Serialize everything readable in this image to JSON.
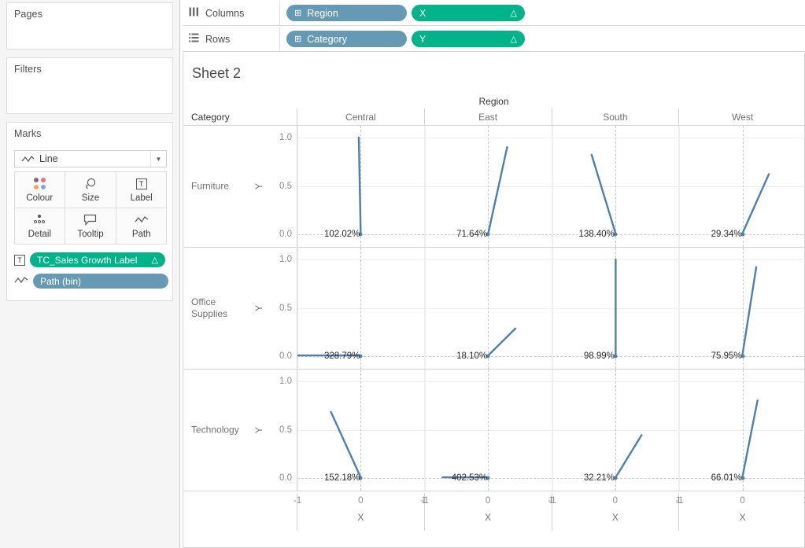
{
  "left_pane": {
    "pages": {
      "title": "Pages"
    },
    "filters": {
      "title": "Filters"
    },
    "marks": {
      "title": "Marks",
      "mark_type": "Line",
      "mark_type_icon": "line-chart-icon",
      "dropdown_arrow": "▼",
      "buttons": [
        {
          "label": "Colour",
          "icon": "colour-dots-icon"
        },
        {
          "label": "Size",
          "icon": "size-circle-icon"
        },
        {
          "label": "Label",
          "icon": "label-t-icon"
        },
        {
          "label": "Detail",
          "icon": "detail-dots-icon"
        },
        {
          "label": "Tooltip",
          "icon": "tooltip-bubble-icon"
        },
        {
          "label": "Path",
          "icon": "path-line-icon"
        }
      ],
      "pills": [
        {
          "icon": "label-t-icon",
          "text": "TC_Sales Growth Label",
          "agg": "△",
          "colour": "green"
        },
        {
          "icon": "path-line-icon",
          "text": "Path (bin)",
          "agg": "",
          "colour": "blue"
        }
      ]
    }
  },
  "shelves": {
    "columns": {
      "label": "Columns",
      "icon": "columns-shelf-icon",
      "pills": [
        {
          "icon": "⊞",
          "text": "Region",
          "agg": "",
          "colour": "blue"
        },
        {
          "icon": "",
          "text": "X",
          "agg": "△",
          "colour": "green"
        }
      ]
    },
    "rows": {
      "label": "Rows",
      "icon": "rows-shelf-icon",
      "pills": [
        {
          "icon": "⊞",
          "text": "Category",
          "agg": "",
          "colour": "blue"
        },
        {
          "icon": "",
          "text": "Y",
          "agg": "△",
          "colour": "green"
        }
      ]
    }
  },
  "view": {
    "sheet_title": "Sheet 2",
    "column_field_caption": "Region",
    "row_field_caption": "Category"
  },
  "chart_data": {
    "type": "line",
    "title": "Sheet 2",
    "xlabel": "X",
    "ylabel": "Y",
    "xlim": [
      -1,
      1
    ],
    "ylim": [
      0,
      1
    ],
    "x_ticks": [
      "-1",
      "0",
      "1"
    ],
    "x_tick_values": [
      -1,
      0,
      1
    ],
    "y_ticks": [
      "0.0",
      "0.5",
      "1.0"
    ],
    "y_tick_values": [
      0.0,
      0.5,
      1.0
    ],
    "grid": true,
    "legend": "none",
    "line_colour": "#4f7faf",
    "columns": [
      "Central",
      "East",
      "South",
      "West"
    ],
    "rows": [
      "Furniture",
      "Office Supplies",
      "Technology"
    ],
    "panels": [
      {
        "row": "Furniture",
        "col": "Central",
        "label": "102.02%",
        "points": [
          [
            0,
            0
          ],
          [
            -0.03,
            1.0
          ]
        ]
      },
      {
        "row": "Furniture",
        "col": "East",
        "label": "71.64%",
        "points": [
          [
            0,
            0
          ],
          [
            0.3,
            0.9
          ]
        ]
      },
      {
        "row": "Furniture",
        "col": "South",
        "label": "138.40%",
        "points": [
          [
            0,
            0
          ],
          [
            -0.38,
            0.82
          ]
        ]
      },
      {
        "row": "Furniture",
        "col": "West",
        "label": "29.34%",
        "points": [
          [
            0,
            0
          ],
          [
            0.42,
            0.62
          ]
        ]
      },
      {
        "row": "Office Supplies",
        "col": "Central",
        "label": "328.79%",
        "points": [
          [
            0,
            0
          ],
          [
            -1.0,
            0
          ]
        ]
      },
      {
        "row": "Office Supplies",
        "col": "East",
        "label": "18.10%",
        "points": [
          [
            0,
            0
          ],
          [
            0.43,
            0.28
          ]
        ]
      },
      {
        "row": "Office Supplies",
        "col": "South",
        "label": "98.99%",
        "points": [
          [
            0,
            0
          ],
          [
            0.0,
            1.0
          ]
        ]
      },
      {
        "row": "Office Supplies",
        "col": "West",
        "label": "75.95%",
        "points": [
          [
            0,
            0
          ],
          [
            0.22,
            0.92
          ]
        ]
      },
      {
        "row": "Technology",
        "col": "Central",
        "label": "152.18%",
        "points": [
          [
            0,
            0
          ],
          [
            -0.47,
            0.68
          ]
        ]
      },
      {
        "row": "Technology",
        "col": "East",
        "label": "402.53%",
        "points": [
          [
            0,
            0
          ],
          [
            -0.72,
            0
          ]
        ]
      },
      {
        "row": "Technology",
        "col": "South",
        "label": "32.21%",
        "points": [
          [
            0,
            0
          ],
          [
            0.41,
            0.44
          ]
        ]
      },
      {
        "row": "Technology",
        "col": "West",
        "label": "66.01%",
        "points": [
          [
            0,
            0
          ],
          [
            0.24,
            0.8
          ]
        ]
      }
    ]
  },
  "colours": {
    "pill_green": "#00b389",
    "pill_blue": "#6699b3",
    "line": "#4f7faf",
    "panel_background": "#ffffff",
    "app_background": "#f5f5f5"
  }
}
